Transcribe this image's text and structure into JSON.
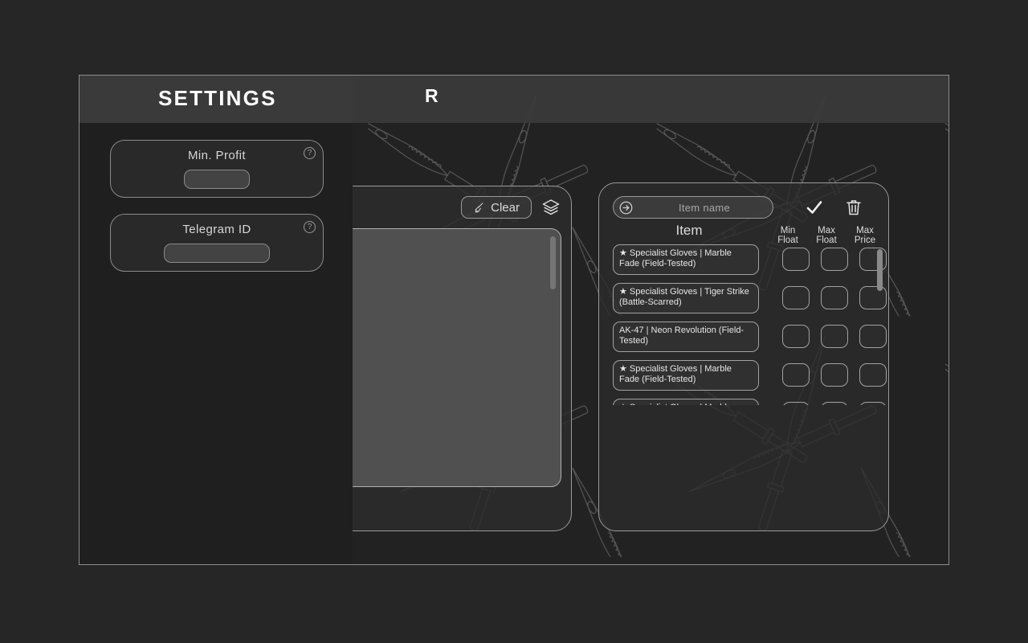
{
  "window": {
    "header": {
      "menu_icon": "hamburger-menu-icon",
      "occluded_title_fragment": "R"
    }
  },
  "settings_overlay": {
    "title": "SETTINGS",
    "help_icon": "?",
    "cards": [
      {
        "label": "Min. Profit",
        "value": "",
        "placeholder": "",
        "help_icon": "question-mark-icon"
      },
      {
        "label": "Telegram ID",
        "value": "",
        "placeholder": "",
        "help_icon": "question-mark-icon"
      }
    ]
  },
  "middle_panel": {
    "clear_label": "Clear",
    "broom_icon": "broom-icon",
    "layers_icon": "layers-icon",
    "textarea_value": ""
  },
  "right_panel": {
    "search": {
      "placeholder": "Item name",
      "value": "",
      "add_icon": "arrow-right-circle-icon",
      "confirm_icon": "checkmark-icon",
      "delete_icon": "trash-icon"
    },
    "columns": {
      "item": "Item",
      "min_float": "Min\nFloat",
      "min_float_line1": "Min",
      "min_float_line2": "Float",
      "max_float_line1": "Max",
      "max_float_line2": "Float",
      "max_price_line1": "Max",
      "max_price_line2": "Price"
    },
    "rows": [
      {
        "name": "★ Specialist Gloves | Marble Fade (Field-Tested)",
        "min_float": "",
        "max_float": "",
        "max_price": ""
      },
      {
        "name": "★ Specialist Gloves | Tiger Strike (Battle-Scarred)",
        "min_float": "",
        "max_float": "",
        "max_price": ""
      },
      {
        "name": "AK-47 | Neon Revolution (Field-Tested)",
        "min_float": "",
        "max_float": "",
        "max_price": ""
      },
      {
        "name": "★ Specialist Gloves | Marble Fade (Field-Tested)",
        "min_float": "",
        "max_float": "",
        "max_price": ""
      },
      {
        "name": "★ Specialist Gloves | Marble Fade (Field-Tested)",
        "min_float": "",
        "max_float": "",
        "max_price": ""
      }
    ]
  },
  "colors": {
    "page_background": "#262626",
    "window_background": "#222222",
    "header_background": "#3a3a3a",
    "panel_background": "#2c2c2c",
    "border": "#9a9a9a",
    "text_primary": "#ffffff",
    "text_secondary": "#dcdcdc",
    "textarea_background": "#505050"
  }
}
